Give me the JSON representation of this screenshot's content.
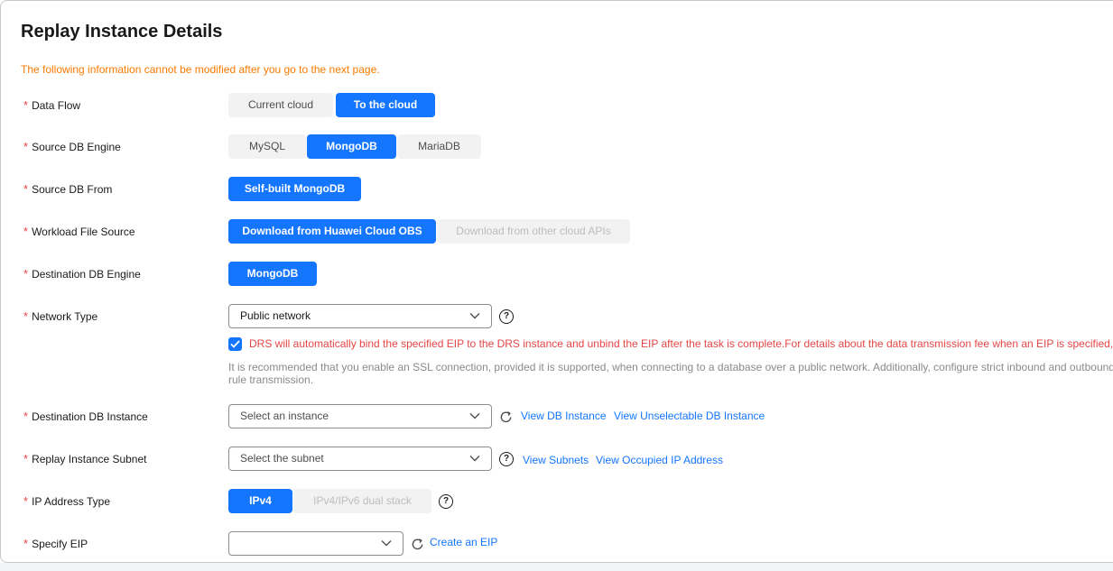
{
  "page": {
    "title": "Replay Instance Details",
    "warning": "The following information cannot be modified after you go to the next page."
  },
  "colors": {
    "accent": "#1476ff",
    "warning": "#fa7a00",
    "error": "#e54545",
    "required": "#e54545"
  },
  "fields": {
    "data_flow": {
      "label": "Data Flow",
      "options": [
        "Current cloud",
        "To the cloud"
      ],
      "selected": "To the cloud"
    },
    "source_db_engine": {
      "label": "Source DB Engine",
      "options": [
        "MySQL",
        "MongoDB",
        "MariaDB"
      ],
      "selected": "MongoDB"
    },
    "source_db_from": {
      "label": "Source DB From",
      "options": [
        "Self-built MongoDB"
      ],
      "selected": "Self-built MongoDB"
    },
    "workload_file_source": {
      "label": "Workload File Source",
      "options": [
        "Download from Huawei Cloud OBS",
        "Download from other cloud APIs"
      ],
      "selected": "Download from Huawei Cloud OBS"
    },
    "destination_db_engine": {
      "label": "Destination DB Engine",
      "options": [
        "MongoDB"
      ],
      "selected": "MongoDB"
    },
    "network_type": {
      "label": "Network Type",
      "value": "Public network",
      "help_icon": "question-circle-icon",
      "auto_bind_checked": true,
      "auto_bind_text": "DRS will automatically bind the specified EIP to the DRS instance and unbind the EIP after the task is complete.For details about the data transmission fee when an EIP is specified, see",
      "ssl_note": "It is recommended that you enable an SSL connection, provided it is supported, when connecting to a database over a public network. Additionally, configure strict inbound and outbound rule transmission."
    },
    "destination_db_instance": {
      "label": "Destination DB Instance",
      "placeholder": "Select an instance",
      "refresh_icon": "refresh-icon",
      "links": [
        "View DB Instance",
        "View Unselectable DB Instance"
      ]
    },
    "replay_instance_subnet": {
      "label": "Replay Instance Subnet",
      "placeholder": "Select the subnet",
      "help_icon": "question-circle-icon",
      "links": [
        "View Subnets",
        "View Occupied IP Address"
      ]
    },
    "ip_address_type": {
      "label": "IP Address Type",
      "options": [
        "IPv4",
        "IPv4/IPv6 dual stack"
      ],
      "selected": "IPv4",
      "help_icon": "question-circle-icon"
    },
    "specify_eip": {
      "label": "Specify EIP",
      "value": "",
      "refresh_icon": "refresh-icon",
      "link": "Create an EIP"
    }
  }
}
